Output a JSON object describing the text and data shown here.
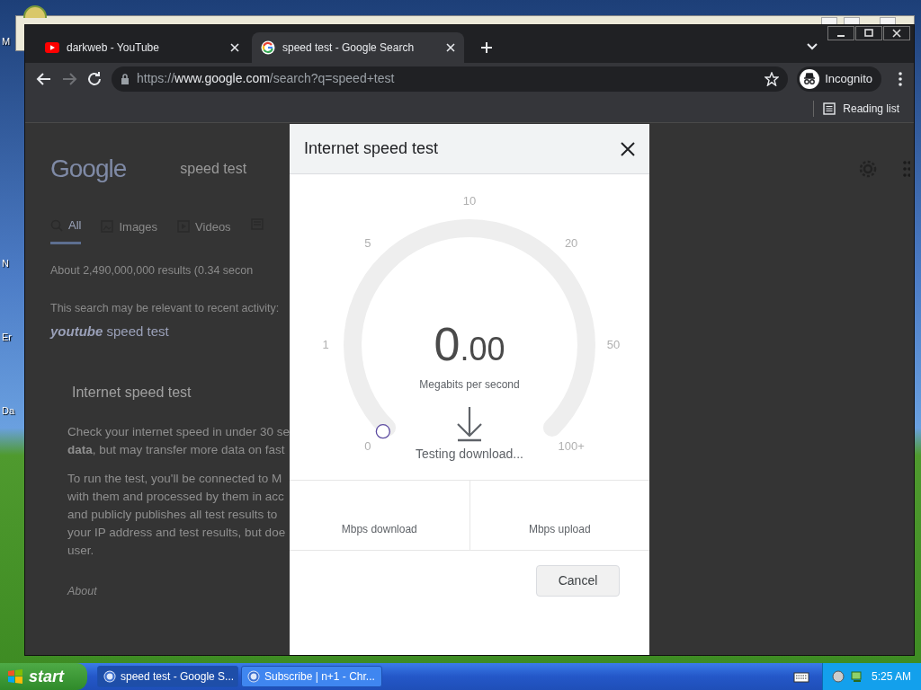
{
  "desktop": {
    "icon_labels": [
      "M",
      "N",
      "Er",
      "Da"
    ]
  },
  "browser": {
    "tabs": [
      {
        "title": "darkweb - YouTube",
        "selected": false
      },
      {
        "title": "speed test - Google Search",
        "selected": true
      }
    ],
    "back": {
      "disabled": false
    },
    "forward": {
      "disabled": true
    },
    "address": {
      "scheme": "https://",
      "host": "www.google.com",
      "path": "/search?q=speed+test"
    },
    "profile": {
      "label": "Incognito"
    },
    "reading_list": "Reading list"
  },
  "page": {
    "logo": "Google",
    "query": "speed test",
    "tabs": [
      {
        "label": "All",
        "selected": true
      },
      {
        "label": "Images",
        "selected": false
      },
      {
        "label": "Videos",
        "selected": false
      }
    ],
    "result_stats": "About 2,490,000,000 results (0.34 secon",
    "recent_note": "This search may be relevant to recent activity:",
    "suggestion": "**youtube** speed test",
    "card_title": "Internet speed test",
    "paragraphs": [
      [
        "Check your internet speed in under 30 se",
        "**data**, but may transfer more data on fast"
      ],
      [
        "To run the test, you'll be connected to M",
        "with them and processed by them in acc",
        "and publicly publishes all test results to",
        "your IP address and test results, but doe",
        "user."
      ]
    ],
    "about": "About"
  },
  "dialog": {
    "title": "Internet speed test",
    "gauge": {
      "ticks": [
        "0",
        "1",
        "5",
        "10",
        "20",
        "50",
        "100+"
      ],
      "reading": "0.00",
      "unit": "Megabits per second",
      "status": "Testing download..."
    },
    "results": [
      {
        "label": "Mbps download"
      },
      {
        "label": "Mbps upload"
      }
    ],
    "cancel": "Cancel"
  },
  "taskbar": {
    "start": "start",
    "tasks": [
      {
        "label": "speed test - Google S...",
        "selected": true
      },
      {
        "label": "Subscribe | n+1 - Chr...",
        "selected": false
      }
    ],
    "clock": "5:25 AM"
  }
}
